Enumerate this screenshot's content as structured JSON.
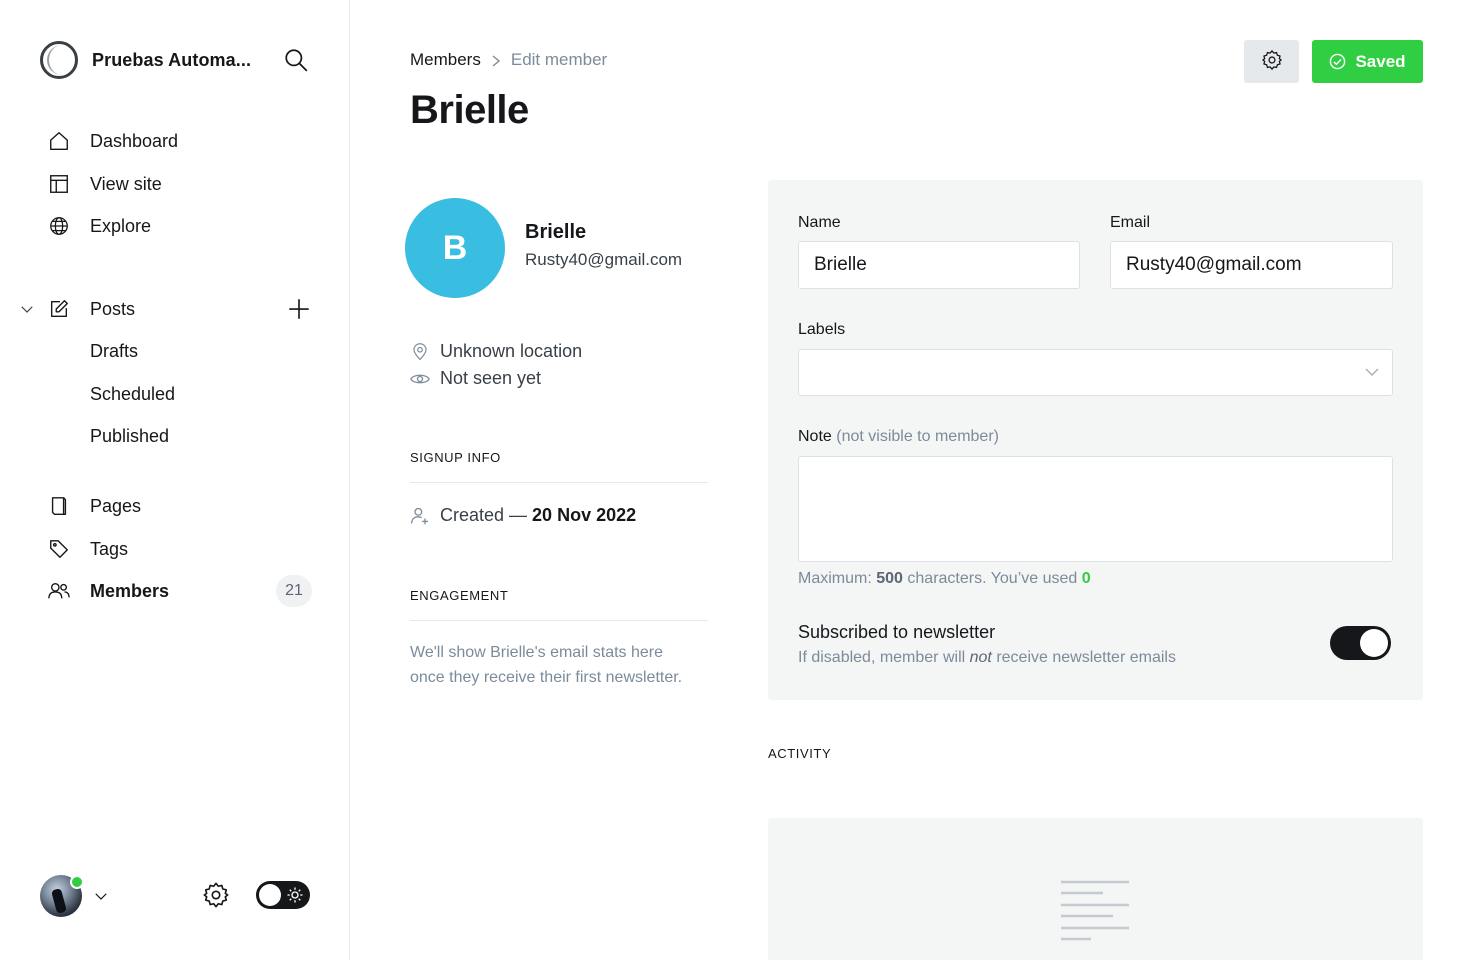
{
  "sidebar": {
    "site_title": "Pruebas Automa...",
    "nav": [
      {
        "label": "Dashboard",
        "icon": "home-icon"
      },
      {
        "label": "View site",
        "icon": "layout-icon"
      },
      {
        "label": "Explore",
        "icon": "globe-icon"
      }
    ],
    "posts": {
      "label": "Posts",
      "icon": "pen-icon",
      "expanded": true,
      "sub": [
        {
          "label": "Drafts"
        },
        {
          "label": "Scheduled"
        },
        {
          "label": "Published"
        }
      ]
    },
    "pages": {
      "label": "Pages",
      "icon": "page-icon"
    },
    "tags": {
      "label": "Tags",
      "icon": "tag-icon"
    },
    "members": {
      "label": "Members",
      "icon": "members-icon",
      "count": "21",
      "active": true
    }
  },
  "header": {
    "breadcrumb_parent": "Members",
    "breadcrumb_current": "Edit member",
    "title": "Brielle",
    "saved_label": "Saved"
  },
  "member": {
    "initial": "B",
    "name": "Brielle",
    "email": "Rusty40@gmail.com",
    "location": "Unknown location",
    "seen": "Not seen yet",
    "avatar_color": "#39bde1"
  },
  "signup": {
    "heading": "SIGNUP INFO",
    "created_prefix": "Created —",
    "created_date": "20 Nov 2022"
  },
  "engagement": {
    "heading": "ENGAGEMENT",
    "text": "We'll show Brielle's email stats here once they receive their first newsletter."
  },
  "form": {
    "name_label": "Name",
    "name_value": "Brielle",
    "email_label": "Email",
    "email_value": "Rusty40@gmail.com",
    "labels_label": "Labels",
    "note_label": "Note",
    "note_hint": "(not visible to member)",
    "note_value": "",
    "max_prefix": "Maximum:",
    "max_value": "500",
    "max_middle": "characters. You’ve used",
    "used_value": "0",
    "newsletter_title": "Subscribed to newsletter",
    "newsletter_desc_before": "If disabled, member will",
    "newsletter_desc_em": "not",
    "newsletter_desc_after": "receive newsletter emails",
    "newsletter_enabled": true
  },
  "activity": {
    "heading": "ACTIVITY"
  },
  "colors": {
    "accent": "#30cf43",
    "dark": "#15171a",
    "muted": "#7c8b9a"
  }
}
